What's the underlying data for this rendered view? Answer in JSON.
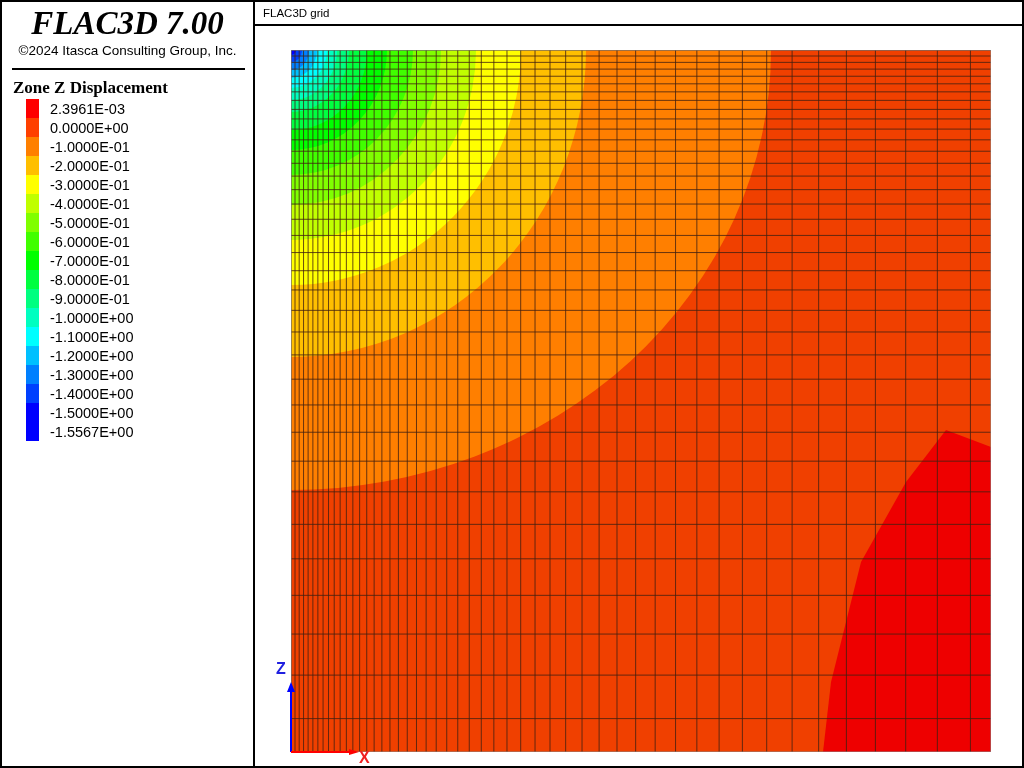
{
  "title": "FLAC3D 7.00",
  "copyright": "©2024 Itasca Consulting Group, Inc.",
  "legend": {
    "title": "Zone Z Displacement",
    "items": [
      {
        "label": "2.3961E-03",
        "color": "#ff0000"
      },
      {
        "label": "0.0000E+00",
        "color": "#ff4000"
      },
      {
        "label": "-1.0000E-01",
        "color": "#ff8000"
      },
      {
        "label": "-2.0000E-01",
        "color": "#ffbf00"
      },
      {
        "label": "-3.0000E-01",
        "color": "#ffff00"
      },
      {
        "label": "-4.0000E-01",
        "color": "#c0ff00"
      },
      {
        "label": "-5.0000E-01",
        "color": "#80ff00"
      },
      {
        "label": "-6.0000E-01",
        "color": "#40ff00"
      },
      {
        "label": "-7.0000E-01",
        "color": "#00ff00"
      },
      {
        "label": "-8.0000E-01",
        "color": "#00ff40"
      },
      {
        "label": "-9.0000E-01",
        "color": "#00ff80"
      },
      {
        "label": "-1.0000E+00",
        "color": "#00ffc0"
      },
      {
        "label": "-1.1000E+00",
        "color": "#00ffff"
      },
      {
        "label": "-1.2000E+00",
        "color": "#00c0ff"
      },
      {
        "label": "-1.3000E+00",
        "color": "#0080ff"
      },
      {
        "label": "-1.4000E+00",
        "color": "#0040ff"
      },
      {
        "label": "-1.5000E+00",
        "color": "#0000ff"
      },
      {
        "label": "-1.5567E+00",
        "color": "#0000ff"
      }
    ]
  },
  "view": {
    "title": "FLAC3D grid",
    "axis_z": "Z",
    "axis_x": "X"
  }
}
